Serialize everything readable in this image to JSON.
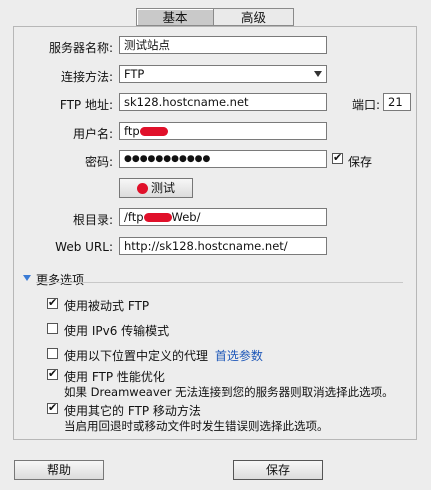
{
  "tabs": [
    {
      "label": "基本"
    },
    {
      "label": "高级"
    }
  ],
  "form": {
    "server_name": {
      "label": "服务器名称:",
      "value": "测试站点"
    },
    "connect_method": {
      "label": "连接方法:",
      "value": "FTP"
    },
    "ftp_address": {
      "label": "FTP 地址:",
      "value": "sk128.hostcname.net"
    },
    "port": {
      "label": "端口:",
      "value": "21"
    },
    "username": {
      "label": "用户名:",
      "value_prefix": "ftp"
    },
    "password": {
      "label": "密码:",
      "value": "●●●●●●●●●●●"
    },
    "save_password": {
      "label": "保存",
      "checked": true
    },
    "test_button": {
      "label": "测试"
    },
    "root_dir": {
      "label": "根目录:",
      "value_prefix": "/ftp",
      "value_suffix": "Web/"
    },
    "web_url": {
      "label": "Web URL:",
      "value": "http://sk128.hostcname.net/"
    }
  },
  "more_options": {
    "title": "更多选项",
    "options": [
      {
        "label": "使用被动式 FTP",
        "checked": true
      },
      {
        "label": "使用 IPv6 传输模式",
        "checked": false
      },
      {
        "label": "使用以下位置中定义的代理",
        "link": "首选参数",
        "checked": false
      },
      {
        "label": "使用 FTP 性能优化",
        "desc": "如果 Dreamweaver 无法连接到您的服务器则取消选择此选项。",
        "checked": true
      },
      {
        "label": "使用其它的 FTP 移动方法",
        "desc": "当启用回退时或移动文件时发生错误则选择此选项。",
        "checked": true
      }
    ]
  },
  "footer": {
    "help_label": "帮助",
    "save_label": "保存"
  },
  "colors": {
    "link": "#1c56b8",
    "redaction": "#e0102a",
    "triangle": "#3a7bd5"
  }
}
